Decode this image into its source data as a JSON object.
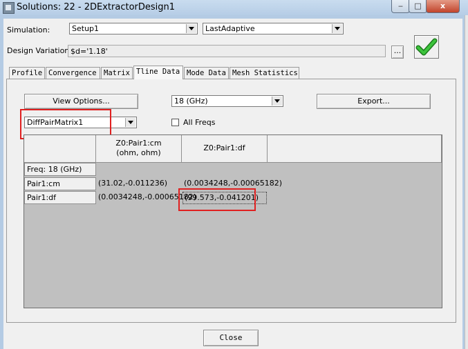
{
  "window": {
    "title": "Solutions: 22 - 2DExtractorDesign1",
    "min_label": "‒",
    "max_label": "□",
    "close_label": "x"
  },
  "simulation": {
    "label": "Simulation:",
    "setup_value": "Setup1",
    "pass_value": "LastAdaptive"
  },
  "design_variation": {
    "label": "Design Variation:",
    "value": "$d='1.18'",
    "browse_label": "..."
  },
  "tabs": [
    {
      "label": "Profile"
    },
    {
      "label": "Convergence"
    },
    {
      "label": "Matrix"
    },
    {
      "label": "Tline Data"
    },
    {
      "label": "Mode Data"
    },
    {
      "label": "Mesh Statistics"
    }
  ],
  "panel": {
    "view_options_label": "View Options...",
    "frequency_value": "18 (GHz)",
    "export_label": "Export...",
    "matrix_value": "DiffPairMatrix1",
    "all_freqs_label": "All Freqs",
    "all_freqs_checked": false
  },
  "grid": {
    "columns": [
      "Z0:Pair1:cm\n(ohm, ohm)",
      "Z0:Pair1:df",
      ""
    ],
    "freq_row_label": "Freq: 18 (GHz)",
    "rows": [
      {
        "label": "Pair1:cm",
        "cells": [
          "(31.02,-0.011236)",
          "(0.0034248,-0.00065182)"
        ]
      },
      {
        "label": "Pair1:df",
        "cells": [
          "(0.0034248,-0.00065182)",
          "(99.573,-0.041201)"
        ]
      }
    ]
  },
  "footer": {
    "close_label": "Close"
  },
  "colors": {
    "highlight": "#e02020",
    "ok_check": "#2fae2f",
    "grid_background": "#c0c0c0"
  }
}
